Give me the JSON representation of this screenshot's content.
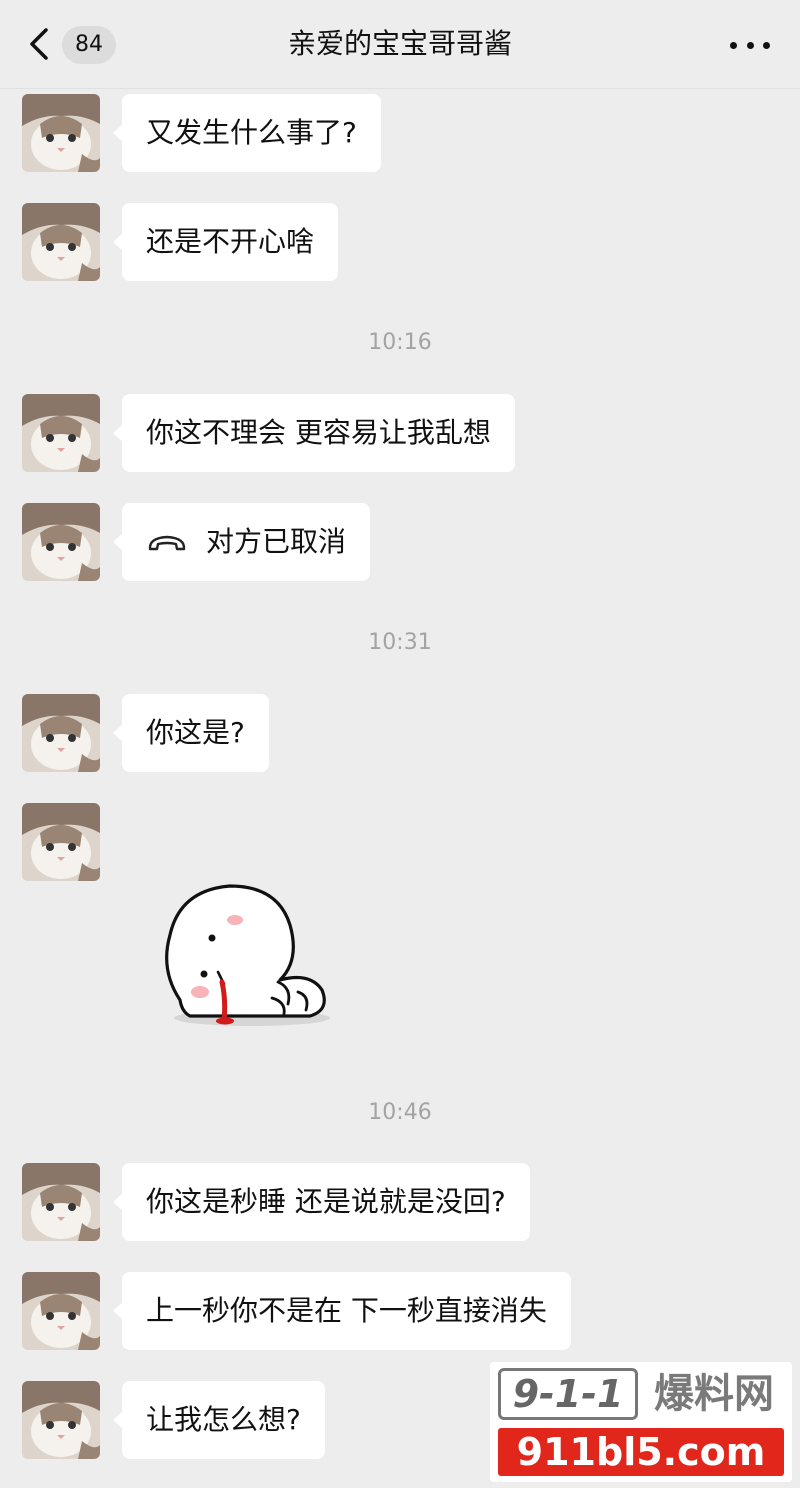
{
  "header": {
    "back_icon": "chevron-left-icon",
    "unread_count": "84",
    "title": "亲爱的宝宝哥哥酱",
    "more_icon": "more-dots-icon"
  },
  "messages": [
    {
      "type": "text",
      "text": "又发生什么事了?"
    },
    {
      "type": "text",
      "text": "还是不开心啥"
    },
    {
      "type": "time",
      "text": "10:16"
    },
    {
      "type": "text",
      "text": "你这不理会 更容易让我乱想"
    },
    {
      "type": "call",
      "icon": "phone-hangup-icon",
      "text": "对方已取消"
    },
    {
      "type": "time",
      "text": "10:31"
    },
    {
      "type": "text",
      "text": "你这是?"
    },
    {
      "type": "sticker",
      "icon": "crying-blob-sticker"
    },
    {
      "type": "time",
      "text": "10:46"
    },
    {
      "type": "text",
      "text": "你这是秒睡 还是说就是没回?"
    },
    {
      "type": "text",
      "text": "上一秒你不是在 下一秒直接消失"
    },
    {
      "type": "text",
      "text": "让我怎么想?"
    }
  ],
  "watermark": {
    "logo_number": "9-1-1",
    "logo_text": "爆料网",
    "url": "911bl5.com",
    "accent_color": "#e1261c"
  },
  "colors": {
    "background": "#ededed",
    "bubble": "#ffffff",
    "timestamp": "#a3a3a3"
  }
}
